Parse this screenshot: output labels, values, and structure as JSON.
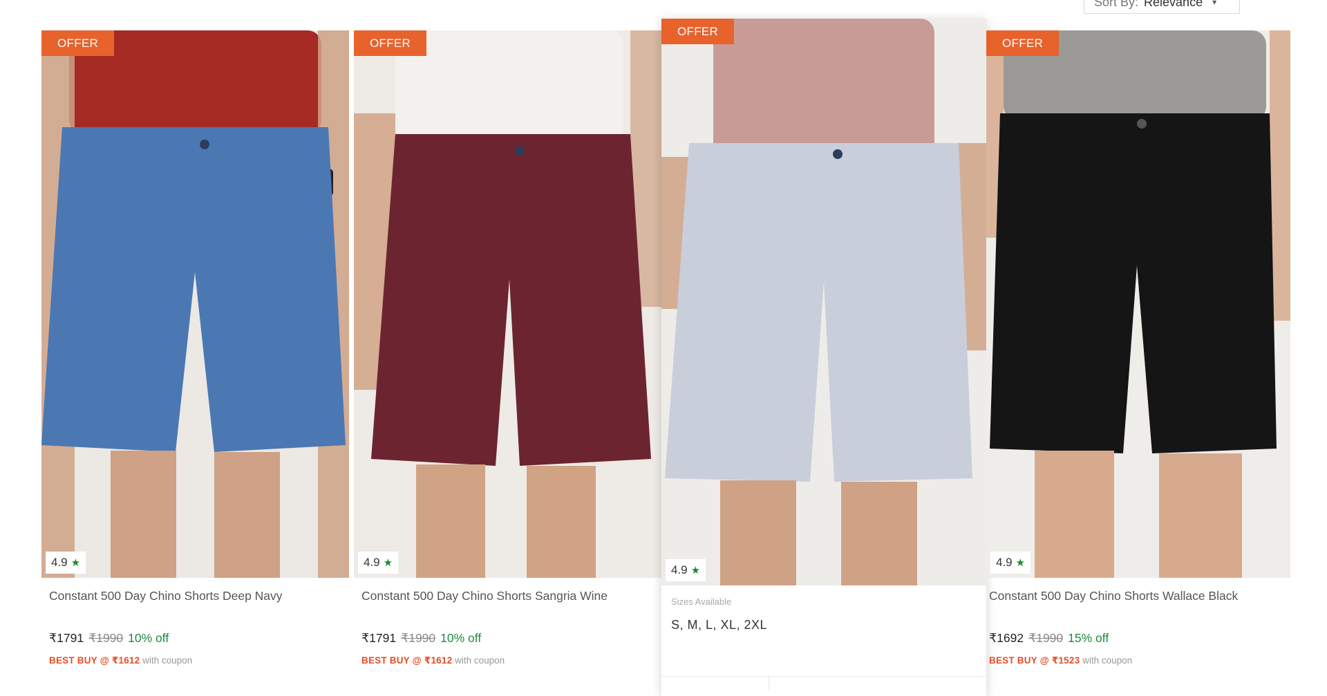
{
  "sort": {
    "label": "Sort By:",
    "value": "Relevance"
  },
  "colors": {
    "offer": "#e8622c",
    "best_buy": "#e44d26",
    "discount": "#1f8a3d",
    "star": "#1a8a2a"
  },
  "products": [
    {
      "badge": "OFFER",
      "rating": "4.9",
      "title": "Constant 500 Day Chino Shorts Deep Navy",
      "price": "₹1791",
      "mrp": "₹1990",
      "discount": "10% off",
      "best_buy": "BEST BUY @ ₹1612",
      "coupon_text": "with coupon",
      "colors": {
        "bg": "#ece8e3",
        "tee": "#a52a24",
        "short": "#4b78b3",
        "skin": "#cfa186"
      }
    },
    {
      "badge": "OFFER",
      "rating": "4.9",
      "title": "Constant 500 Day Chino Shorts Sangria Wine",
      "price": "₹1791",
      "mrp": "₹1990",
      "discount": "10% off",
      "best_buy": "BEST BUY @ ₹1612",
      "coupon_text": "with coupon",
      "colors": {
        "bg": "#eeebe6",
        "tee": "#f2f1ee",
        "short": "#6d2431",
        "skin": "#d0a385"
      }
    },
    {
      "badge": "OFFER",
      "rating": "4.9",
      "sizes_label": "Sizes Available",
      "sizes": "S, M, L, XL, 2XL",
      "colors": {
        "bg": "#eeece8",
        "tee": "#c89b97",
        "short": "#c9cedb",
        "skin": "#cfa286"
      }
    },
    {
      "badge": "OFFER",
      "rating": "4.9",
      "title": "Constant 500 Day Chino Shorts Wallace Black",
      "price": "₹1692",
      "mrp": "₹1990",
      "discount": "15% off",
      "best_buy": "BEST BUY @ ₹1523",
      "coupon_text": "with coupon",
      "colors": {
        "bg": "#efede9",
        "tee": "#9c9a97",
        "short": "#151515",
        "skin": "#d7aa8d"
      }
    }
  ]
}
